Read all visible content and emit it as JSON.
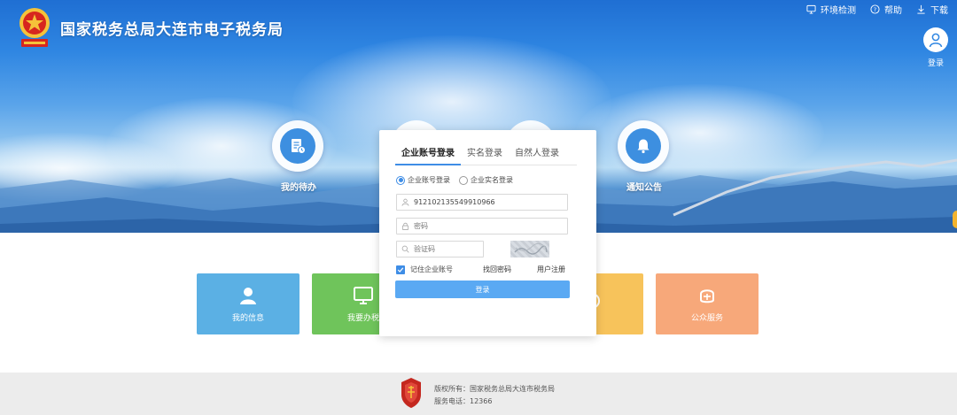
{
  "header": {
    "site_title": "国家税务总局大连市电子税务局",
    "top_links": [
      {
        "label": "环境检测",
        "icon": "monitor-icon"
      },
      {
        "label": "帮助",
        "icon": "help-icon"
      },
      {
        "label": "下载",
        "icon": "download-icon"
      }
    ],
    "login_label": "登录"
  },
  "hero_icons": [
    {
      "label": "我的待办",
      "icon": "document-clock-icon"
    },
    {
      "label": "通知公告",
      "icon": "bell-icon"
    }
  ],
  "tiles": [
    {
      "label": "我的信息",
      "color": "#5bb0e4",
      "icon": "user-icon"
    },
    {
      "label": "我要办税",
      "color": "#6fc45b",
      "icon": "monitor-icon"
    },
    {
      "label": "",
      "color": "#f7c35b",
      "icon": "chat-icon"
    },
    {
      "label": "公众服务",
      "color": "#f7a87a",
      "icon": "service-icon"
    }
  ],
  "login": {
    "tabs": [
      "企业账号登录",
      "实名登录",
      "自然人登录"
    ],
    "radios": [
      "企业账号登录",
      "企业实名登录"
    ],
    "account_value": "912102135549910966",
    "password_placeholder": "密码",
    "captcha_placeholder": "验证码",
    "remember_label": "记住企业账号",
    "forgot_label": "找回密码",
    "register_label": "用户注册",
    "submit_label": "登录"
  },
  "footer": {
    "copyright": "版权所有：国家税务总局大连市税务局",
    "phone": "服务电话：12366"
  },
  "colors": {
    "accent": "#3e8de6",
    "button": "#5aa9f3",
    "footer_bg": "#ececec"
  }
}
